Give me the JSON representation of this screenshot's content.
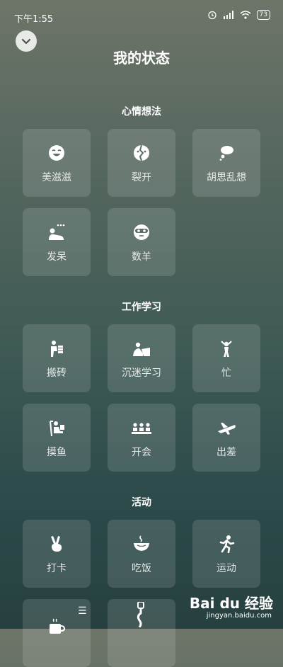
{
  "status": {
    "time": "下午1:55",
    "battery": "73"
  },
  "page": {
    "title": "我的状态"
  },
  "sections": [
    {
      "title": "心情想法",
      "items": [
        {
          "label": "美滋滋",
          "icon": "smile-icon"
        },
        {
          "label": "裂开",
          "icon": "cracked-face-icon"
        },
        {
          "label": "胡思乱想",
          "icon": "thought-cloud-icon"
        },
        {
          "label": "发呆",
          "icon": "daze-icon"
        },
        {
          "label": "数羊",
          "icon": "sleep-mask-icon"
        }
      ]
    },
    {
      "title": "工作学习",
      "items": [
        {
          "label": "搬砖",
          "icon": "carry-bricks-icon"
        },
        {
          "label": "沉迷学习",
          "icon": "study-icon"
        },
        {
          "label": "忙",
          "icon": "busy-icon"
        },
        {
          "label": "摸鱼",
          "icon": "slack-off-icon"
        },
        {
          "label": "开会",
          "icon": "meeting-icon"
        },
        {
          "label": "出差",
          "icon": "airplane-icon"
        }
      ]
    },
    {
      "title": "活动",
      "items": [
        {
          "label": "打卡",
          "icon": "peace-hand-icon"
        },
        {
          "label": "吃饭",
          "icon": "bowl-icon"
        },
        {
          "label": "运动",
          "icon": "running-icon"
        }
      ]
    }
  ],
  "watermark": {
    "brand": "Bai du 经验",
    "url": "jingyan.baidu.com"
  },
  "partial_icons": [
    "coffee-icon",
    "figure-icon"
  ]
}
